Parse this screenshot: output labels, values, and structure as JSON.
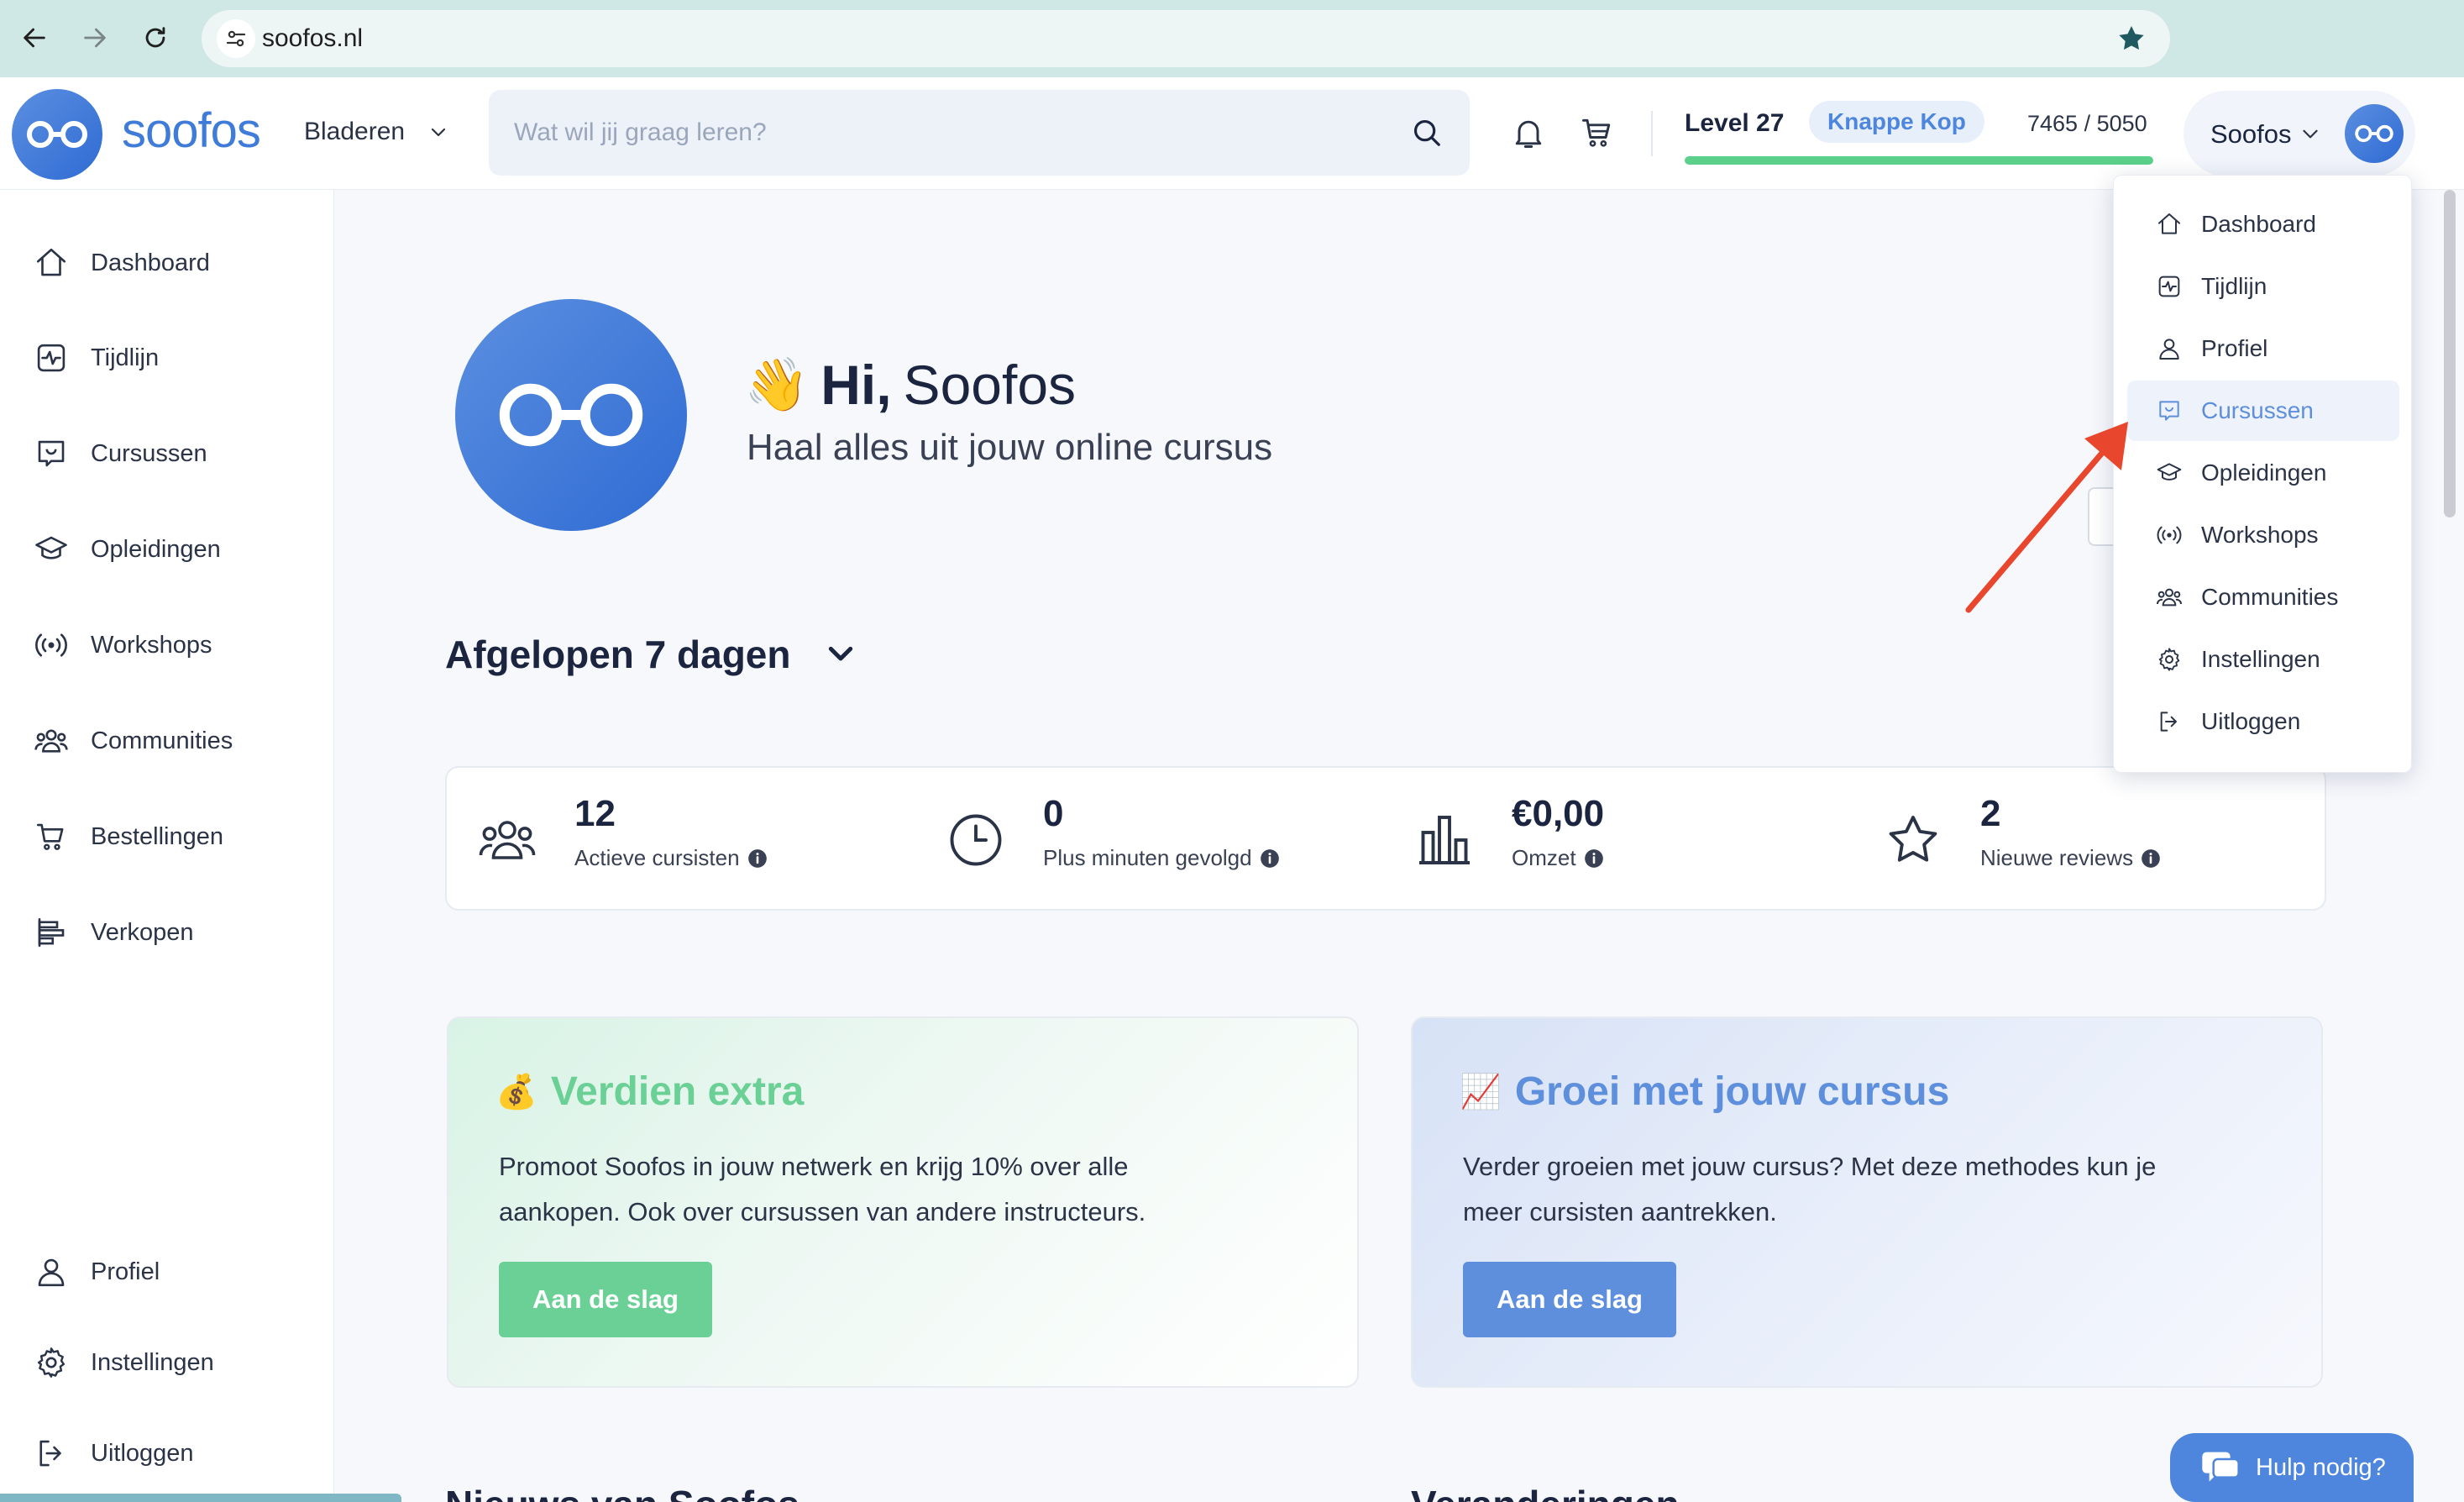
{
  "browser": {
    "url": "soofos.nl"
  },
  "header": {
    "logo_text": "soofos",
    "browse_label": "Bladeren",
    "search_placeholder": "Wat wil jij graag leren?",
    "level_label": "Level 27",
    "level_badge": "Knappe Kop",
    "xp_text": "7465 / 5050",
    "xp_progress": 1.0,
    "user_name": "Soofos"
  },
  "sidebar": {
    "items": [
      {
        "label": "Dashboard",
        "icon": "home-icon"
      },
      {
        "label": "Tijdlijn",
        "icon": "timeline-icon"
      },
      {
        "label": "Cursussen",
        "icon": "courses-icon"
      },
      {
        "label": "Opleidingen",
        "icon": "graduation-cap-icon"
      },
      {
        "label": "Workshops",
        "icon": "broadcast-icon"
      },
      {
        "label": "Communities",
        "icon": "users-icon"
      },
      {
        "label": "Bestellingen",
        "icon": "cart-icon"
      },
      {
        "label": "Verkopen",
        "icon": "sales-icon"
      }
    ],
    "bottom_items": [
      {
        "label": "Profiel",
        "icon": "user-icon"
      },
      {
        "label": "Instellingen",
        "icon": "gear-icon"
      },
      {
        "label": "Uitloggen",
        "icon": "logout-icon"
      }
    ]
  },
  "main": {
    "greeting_emoji": "👋",
    "greeting_bold": "Hi,",
    "greeting_name": "Soofos",
    "subtitle": "Haal alles uit jouw online cursus",
    "period_label": "Afgelopen 7 dagen",
    "stats": [
      {
        "value": "12",
        "label": "Actieve cursisten",
        "icon": "users-icon"
      },
      {
        "value": "0",
        "label": "Plus minuten gevolgd",
        "icon": "clock-icon"
      },
      {
        "value": "€0,00",
        "label": "Omzet",
        "icon": "bar-chart-icon"
      },
      {
        "value": "2",
        "label": "Nieuwe reviews",
        "icon": "star-icon"
      }
    ],
    "cards": [
      {
        "emoji": "💰",
        "title": "Verdien extra",
        "text": "Promoot Soofos in jouw netwerk en krijg 10% over alle aankopen. Ook over cursussen van andere instructeurs.",
        "button": "Aan de slag"
      },
      {
        "emoji": "📈",
        "title": "Groei met jouw cursus",
        "text": "Verder groeien met jouw cursus? Met deze methodes kun je meer cursisten aantrekken.",
        "button": "Aan de slag"
      }
    ],
    "partial_headings": [
      "Nieuws van Soofos",
      "Veranderingen"
    ]
  },
  "dropdown": {
    "items": [
      {
        "label": "Dashboard",
        "icon": "home-icon"
      },
      {
        "label": "Tijdlijn",
        "icon": "timeline-icon"
      },
      {
        "label": "Profiel",
        "icon": "user-icon"
      },
      {
        "label": "Cursussen",
        "icon": "courses-icon",
        "active": true
      },
      {
        "label": "Opleidingen",
        "icon": "graduation-cap-icon"
      },
      {
        "label": "Workshops",
        "icon": "broadcast-icon"
      },
      {
        "label": "Communities",
        "icon": "users-icon"
      },
      {
        "label": "Instellingen",
        "icon": "gear-icon"
      },
      {
        "label": "Uitloggen",
        "icon": "logout-icon"
      }
    ]
  },
  "help": {
    "label": "Hulp nodig?"
  },
  "colors": {
    "brand_blue": "#3f7bd8",
    "accent_green": "#6bd095",
    "accent_blue": "#5e8fdc",
    "annotation_red": "#e8472e"
  }
}
